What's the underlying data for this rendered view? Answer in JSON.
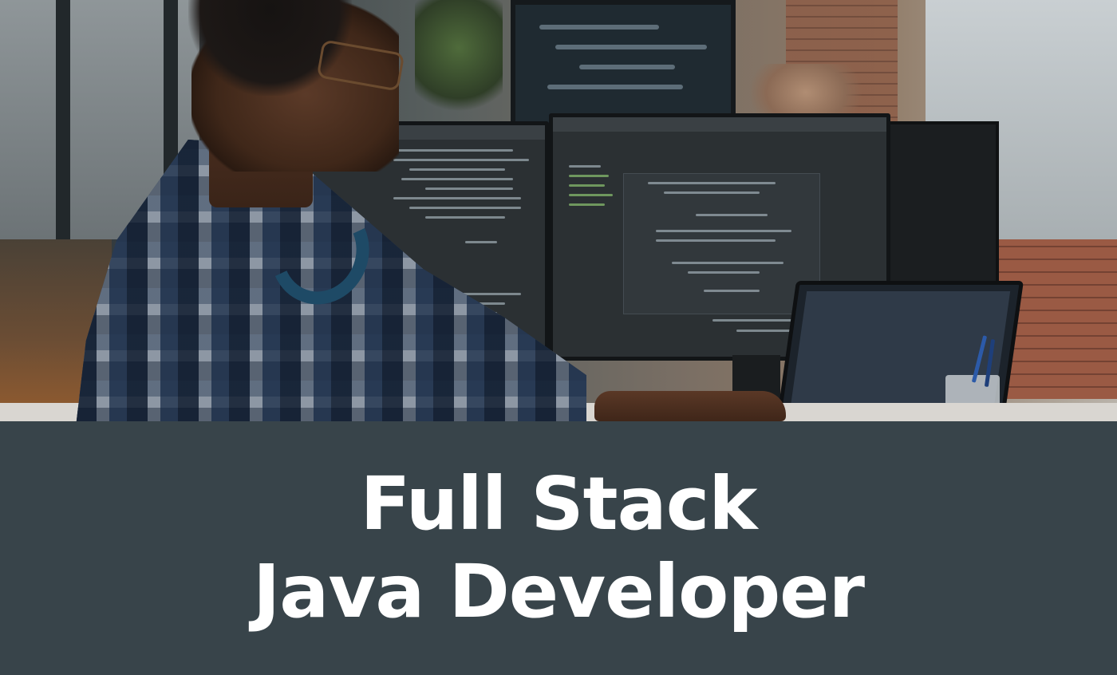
{
  "banner": {
    "title_line_1": "Full Stack",
    "title_line_2": "Java Developer"
  },
  "colors": {
    "band_background": "#38444a",
    "title_text": "#ffffff"
  },
  "photo": {
    "subject": "developer-at-multi-monitor-desk"
  }
}
